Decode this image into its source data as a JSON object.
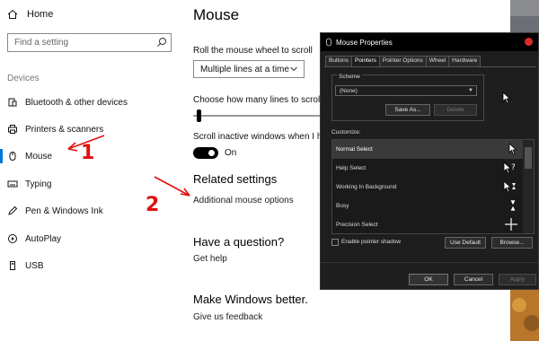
{
  "sidebar": {
    "home_label": "Home",
    "search_placeholder": "Find a setting",
    "section": "Devices",
    "items": [
      {
        "label": "Bluetooth & other devices",
        "icon": "bluetooth-icon"
      },
      {
        "label": "Printers & scanners",
        "icon": "printer-icon"
      },
      {
        "label": "Mouse",
        "icon": "mouse-icon",
        "selected": true
      },
      {
        "label": "Typing",
        "icon": "keyboard-icon"
      },
      {
        "label": "Pen & Windows Ink",
        "icon": "pen-icon"
      },
      {
        "label": "AutoPlay",
        "icon": "autoplay-icon"
      },
      {
        "label": "USB",
        "icon": "usb-icon"
      }
    ]
  },
  "main": {
    "title": "Mouse",
    "scroll_label": "Roll the mouse wheel to scroll",
    "scroll_value": "Multiple lines at a time",
    "lines_label": "Choose how many lines to scroll e",
    "inactive_label": "Scroll inactive windows when I ho",
    "inactive_state": "On",
    "related_heading": "Related settings",
    "related_link": "Additional mouse options",
    "question_heading": "Have a question?",
    "help_link": "Get help",
    "better_heading": "Make Windows better.",
    "feedback_link": "Give us feedback"
  },
  "dialog": {
    "title": "Mouse Properties",
    "tabs": [
      "Buttons",
      "Pointers",
      "Pointer Options",
      "Wheel",
      "Hardware"
    ],
    "active_tab": "Pointers",
    "scheme_label": "Scheme",
    "scheme_value": "(None)",
    "save_as": "Save As...",
    "delete": "Delete",
    "customize_label": "Customize:",
    "cursors": [
      {
        "label": "Normal Select",
        "icon": "arrow-cursor-icon"
      },
      {
        "label": "Help Select",
        "icon": "help-cursor-icon"
      },
      {
        "label": "Working In Background",
        "icon": "working-cursor-icon"
      },
      {
        "label": "Busy",
        "icon": "hourglass-cursor-icon"
      },
      {
        "label": "Precision Select",
        "icon": "crosshair-cursor-icon"
      }
    ],
    "shadow_label": "Enable pointer shadow",
    "use_default": "Use Default",
    "browse": "Browse...",
    "ok": "OK",
    "cancel": "Cancel",
    "apply": "Apply"
  },
  "annotations": {
    "step1": "1",
    "step2": "2"
  },
  "colors": {
    "accent": "#0078d7",
    "annotation": "#e01010",
    "dialog_bg": "#1e1e1e"
  }
}
